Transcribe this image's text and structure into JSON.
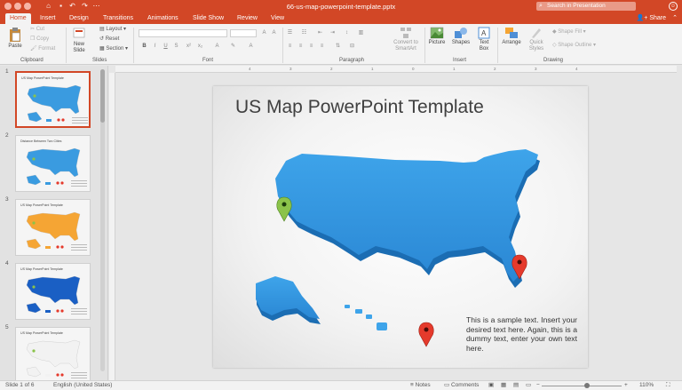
{
  "window": {
    "title": "66-us-map-powerpoint-template.pptx",
    "search_placeholder": "Search in Presentation",
    "share_label": "Share"
  },
  "tabs": [
    {
      "label": "Home",
      "active": true
    },
    {
      "label": "Insert"
    },
    {
      "label": "Design"
    },
    {
      "label": "Transitions"
    },
    {
      "label": "Animations"
    },
    {
      "label": "Slide Show"
    },
    {
      "label": "Review"
    },
    {
      "label": "View"
    }
  ],
  "ribbon": {
    "clipboard": {
      "paste": "Paste",
      "cut": "Cut",
      "copy": "Copy",
      "format": "Format",
      "group": "Clipboard"
    },
    "slides": {
      "new_slide": "New Slide",
      "layout": "Layout",
      "reset": "Reset",
      "section": "Section",
      "group": "Slides"
    },
    "font_group": "Font",
    "paragraph": {
      "convert": "Convert to SmartArt",
      "group": "Paragraph"
    },
    "insert": {
      "picture": "Picture",
      "shapes": "Shapes",
      "textbox": "Text Box",
      "group": "Insert"
    },
    "drawing": {
      "arrange": "Arrange",
      "quick_styles": "Quick Styles",
      "shape_fill": "Shape Fill",
      "shape_outline": "Shape Outline",
      "group": "Drawing"
    }
  },
  "slides": [
    {
      "number": "1",
      "title": "US Map PowerPoint Template",
      "map_color": "#3a9be0",
      "selected": true
    },
    {
      "number": "2",
      "title": "Distance Between Two Cities",
      "map_color": "#3a9be0"
    },
    {
      "number": "3",
      "title": "US Map PowerPoint Template",
      "map_color": "#f5a534"
    },
    {
      "number": "4",
      "title": "US Map PowerPoint Template",
      "map_color": "#1a5fc4"
    },
    {
      "number": "5",
      "title": "US Map PowerPoint Template",
      "map_color": "#f2f2f2"
    }
  ],
  "ruler": [
    "4",
    "3",
    "2",
    "1",
    "0",
    "1",
    "2",
    "3",
    "4"
  ],
  "current_slide": {
    "title": "US Map PowerPoint Template",
    "body": "This is a sample text. Insert your desired text here. Again, this is a dummy text, enter your own text here.",
    "map_color": "#3ea4ea",
    "pin_green": "#8bc34a",
    "pin_red": "#e53a2c"
  },
  "status": {
    "slide_of": "Slide 1 of 6",
    "language": "English (United States)",
    "notes": "Notes",
    "comments": "Comments",
    "zoom": "110%"
  }
}
